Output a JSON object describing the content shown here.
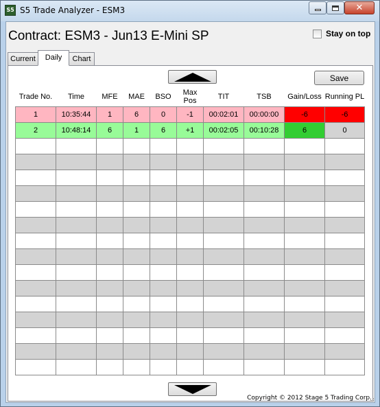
{
  "window": {
    "title": "S5 Trade Analyzer - ESM3",
    "icon_text": "S5"
  },
  "header": {
    "contract_title": "Contract: ESM3 - Jun13 E-Mini SP",
    "stay_on_top_label": "Stay on top",
    "stay_on_top_checked": false
  },
  "tabs": [
    {
      "label": "Current",
      "active": false
    },
    {
      "label": "Daily",
      "active": true
    },
    {
      "label": "Chart",
      "active": false
    }
  ],
  "toolbar": {
    "save_label": "Save",
    "scroll_up_icon": "triangle-up-icon",
    "scroll_down_icon": "triangle-down-icon"
  },
  "grid": {
    "columns": [
      "Trade No.",
      "Time",
      "MFE",
      "MAE",
      "BSO",
      "Max Pos",
      "TIT",
      "TSB",
      "Gain/Loss",
      "Running PL"
    ],
    "rows": [
      {
        "cells": [
          "1",
          "10:35:44",
          "1",
          "6",
          "0",
          "-1",
          "00:02:01",
          "00:00:00",
          "-6",
          "-6"
        ],
        "row_color": "#ffb6c1",
        "gain_color": "#ff0000",
        "running_color": "#ff0000"
      },
      {
        "cells": [
          "2",
          "10:48:14",
          "6",
          "1",
          "6",
          "+1",
          "00:02:05",
          "00:10:28",
          "6",
          "0"
        ],
        "row_color": "#98fb98",
        "gain_color": "#32cd32",
        "running_color": "#d3d3d3"
      }
    ],
    "empty_row_count": 15
  },
  "footer": {
    "copyright": "Copyright © 2012 Stage 5 Trading Corp."
  }
}
